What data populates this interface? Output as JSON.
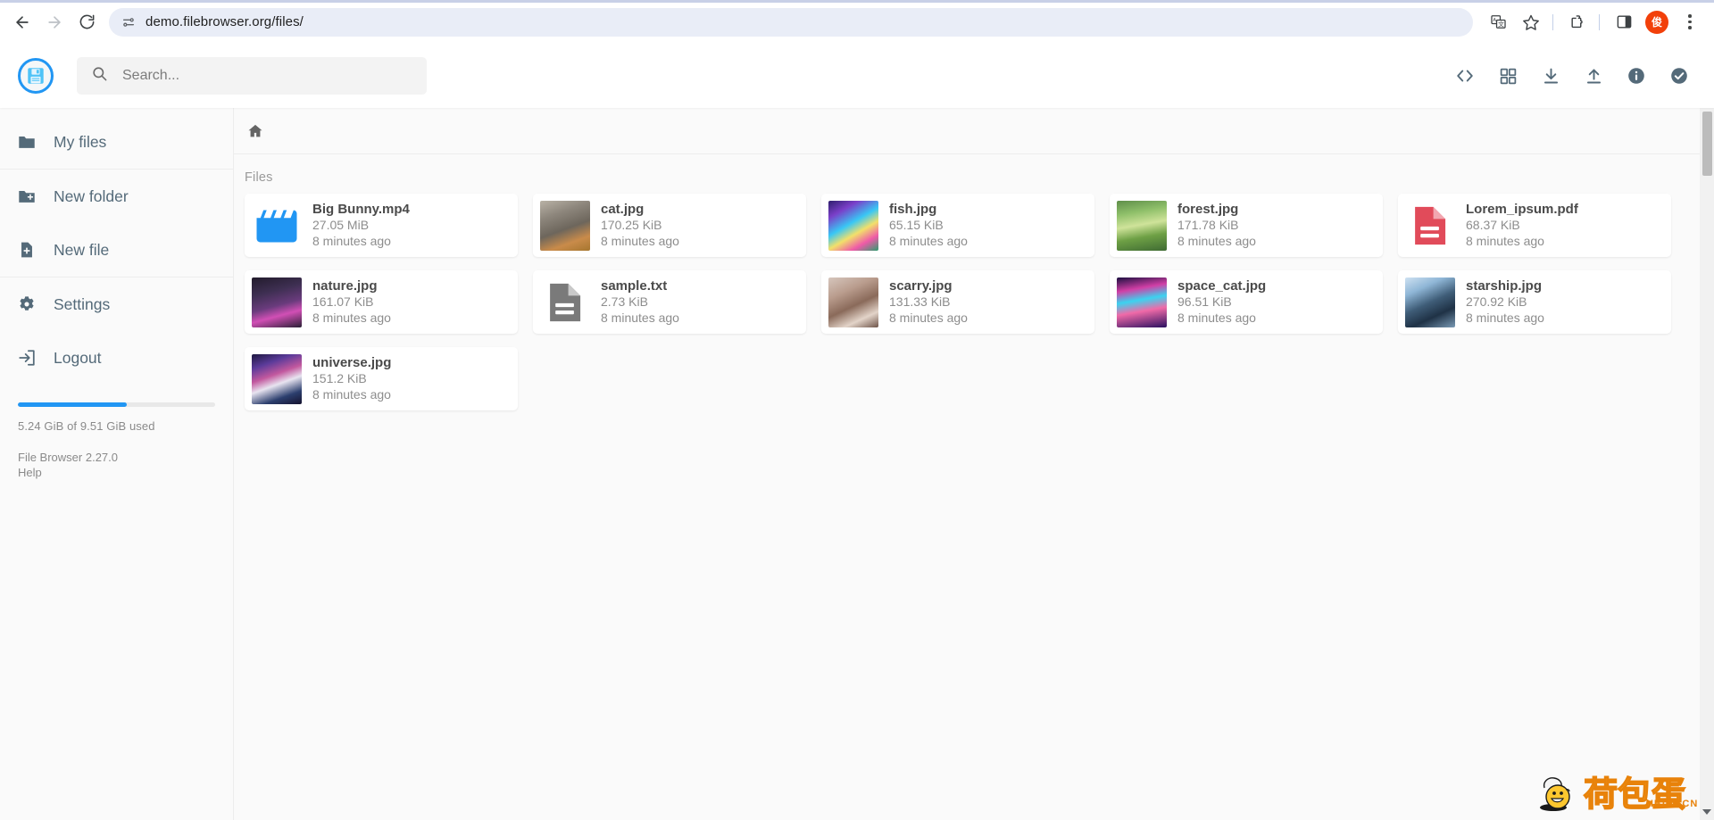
{
  "browser": {
    "url": "demo.filebrowser.org/files/",
    "back_icon": "back-arrow-icon",
    "forward_icon": "forward-arrow-icon",
    "reload_icon": "reload-icon",
    "site_info_icon": "site-settings-icon",
    "translate_icon": "translate-icon",
    "bookmark_icon": "star-icon",
    "extensions_icon": "puzzle-icon",
    "side_panel_icon": "side-panel-icon",
    "avatar_label": "俊",
    "menu_icon": "three-dot-menu-icon"
  },
  "header": {
    "logo_icon": "floppy-disk-logo",
    "search": {
      "placeholder": "Search...",
      "value": "",
      "icon": "search-icon"
    },
    "actions": [
      {
        "name": "code-view-button",
        "icon": "code-brackets-icon",
        "label": "<>"
      },
      {
        "name": "switch-view-button",
        "icon": "grid-view-icon",
        "label": ""
      },
      {
        "name": "download-button",
        "icon": "download-icon",
        "label": ""
      },
      {
        "name": "upload-button",
        "icon": "upload-icon",
        "label": ""
      },
      {
        "name": "info-button",
        "icon": "info-circle-icon",
        "label": ""
      },
      {
        "name": "select-multiple-button",
        "icon": "check-circle-icon",
        "label": ""
      }
    ]
  },
  "sidebar": {
    "groups": [
      {
        "items": [
          {
            "label": "My files",
            "icon": "folder-icon",
            "name": "sidebar-item-my-files"
          }
        ]
      },
      {
        "items": [
          {
            "label": "New folder",
            "icon": "folder-plus-icon",
            "name": "sidebar-item-new-folder"
          },
          {
            "label": "New file",
            "icon": "file-plus-icon",
            "name": "sidebar-item-new-file"
          }
        ]
      },
      {
        "items": [
          {
            "label": "Settings",
            "icon": "gear-icon",
            "name": "sidebar-item-settings"
          },
          {
            "label": "Logout",
            "icon": "logout-icon",
            "name": "sidebar-item-logout"
          }
        ]
      }
    ],
    "storage": {
      "used_percent": 55,
      "text": "5.24 GiB of 9.51 GiB used",
      "bar_color": "#2196f3"
    },
    "version": "File Browser 2.27.0",
    "help": "Help"
  },
  "main": {
    "breadcrumb": {
      "home_icon": "home-icon",
      "path": "/"
    },
    "section_label": "Files",
    "files": [
      {
        "name": "Big Bunny.mp4",
        "size": "27.05 MiB",
        "time": "8 minutes ago",
        "kind": "video",
        "icon": "video-clapper-icon",
        "color": "#2196f3"
      },
      {
        "name": "cat.jpg",
        "size": "170.25 KiB",
        "time": "8 minutes ago",
        "kind": "image",
        "icon": "image-thumbnail",
        "thumb": "cat"
      },
      {
        "name": "fish.jpg",
        "size": "65.15 KiB",
        "time": "8 minutes ago",
        "kind": "image",
        "icon": "image-thumbnail",
        "thumb": "fish"
      },
      {
        "name": "forest.jpg",
        "size": "171.78 KiB",
        "time": "8 minutes ago",
        "kind": "image",
        "icon": "image-thumbnail",
        "thumb": "forest"
      },
      {
        "name": "Lorem_ipsum.pdf",
        "size": "68.37 KiB",
        "time": "8 minutes ago",
        "kind": "pdf",
        "icon": "pdf-file-icon",
        "color": "#e14b5a"
      },
      {
        "name": "nature.jpg",
        "size": "161.07 KiB",
        "time": "8 minutes ago",
        "kind": "image",
        "icon": "image-thumbnail",
        "thumb": "nature"
      },
      {
        "name": "sample.txt",
        "size": "2.73 KiB",
        "time": "8 minutes ago",
        "kind": "text",
        "icon": "text-file-icon",
        "color": "#7a7a7a"
      },
      {
        "name": "scarry.jpg",
        "size": "131.33 KiB",
        "time": "8 minutes ago",
        "kind": "image",
        "icon": "image-thumbnail",
        "thumb": "scarry"
      },
      {
        "name": "space_cat.jpg",
        "size": "96.51 KiB",
        "time": "8 minutes ago",
        "kind": "image",
        "icon": "image-thumbnail",
        "thumb": "spacecat"
      },
      {
        "name": "starship.jpg",
        "size": "270.92 KiB",
        "time": "8 minutes ago",
        "kind": "image",
        "icon": "image-thumbnail",
        "thumb": "starship"
      },
      {
        "name": "universe.jpg",
        "size": "151.2 KiB",
        "time": "8 minutes ago",
        "kind": "image",
        "icon": "image-thumbnail",
        "thumb": "universe"
      }
    ]
  },
  "watermark": {
    "text": "荷包蛋",
    "sub": "HBDO.CN"
  }
}
